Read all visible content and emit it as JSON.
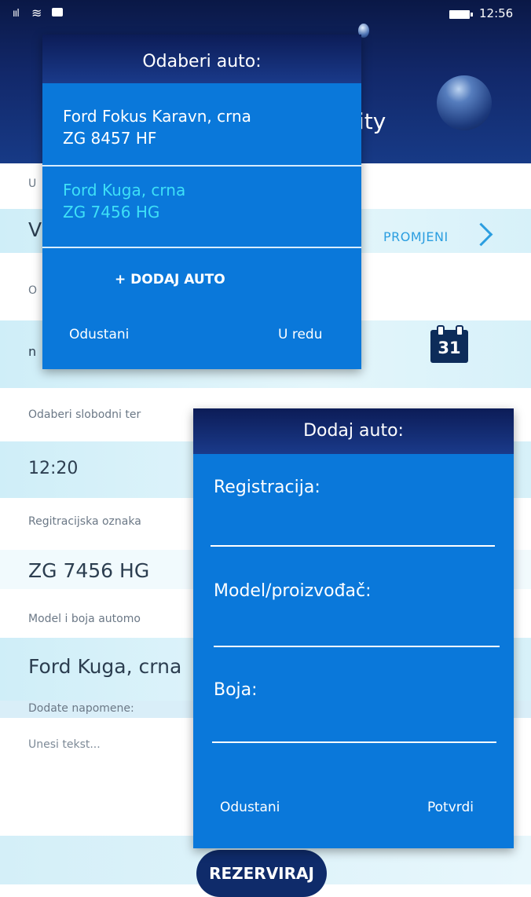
{
  "status": {
    "signal": "ııl",
    "wifi": "≋",
    "time": "12:56"
  },
  "header": {
    "title_partial": "ity"
  },
  "form": {
    "row1": {
      "label_partial": "U",
      "value_partial": "V",
      "change": "PROMJENI"
    },
    "row2": {
      "label_partial": "O",
      "value_partial": "n",
      "calendar_day": "31"
    },
    "time_slot": {
      "label": "Odaberi slobodni ter",
      "value": "12:20"
    },
    "registration": {
      "label": "Regitracijska oznaka",
      "value": "ZG 7456 HG"
    },
    "model": {
      "label": "Model i boja automo",
      "value": "Ford Kuga, crna"
    },
    "notes": {
      "label": "Dodate napomene:",
      "placeholder": "Unesi tekst..."
    },
    "reserve_button": "REZERVIRAJ"
  },
  "choose_car_dialog": {
    "title": "Odaberi auto:",
    "cars": [
      {
        "name": "Ford Fokus Karavn, crna",
        "plate": "ZG 8457 HF"
      },
      {
        "name": "Ford Kuga, crna",
        "plate": "ZG 7456 HG"
      }
    ],
    "add_car": "+ DODAJ AUTO",
    "cancel": "Odustani",
    "ok": "U redu"
  },
  "add_car_dialog": {
    "title": "Dodaj auto:",
    "fields": [
      {
        "label": "Registracija:",
        "value": ""
      },
      {
        "label": "Model/proizvođač:",
        "value": ""
      },
      {
        "label": "Boja:",
        "value": ""
      }
    ],
    "cancel": "Odustani",
    "confirm": "Potvrdi"
  }
}
